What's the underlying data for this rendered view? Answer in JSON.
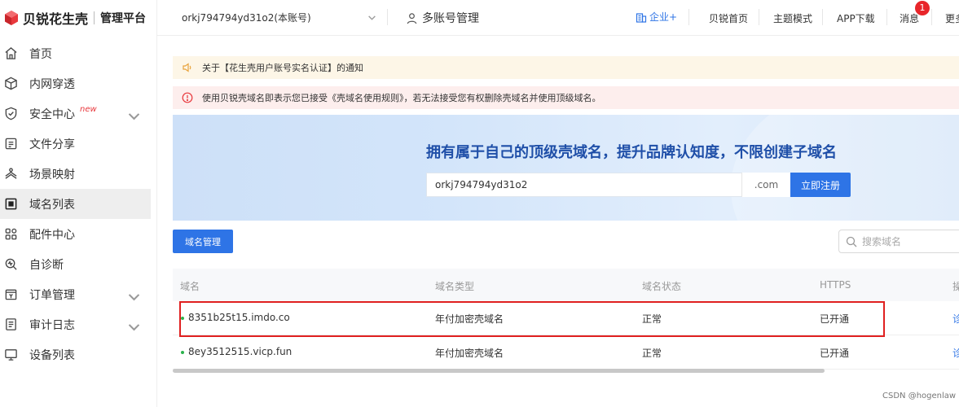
{
  "brand": {
    "name": "贝锐花生壳",
    "subtitle": "管理平台"
  },
  "sidebar": {
    "items": [
      {
        "label": "首页",
        "icon": "home-icon"
      },
      {
        "label": "内网穿透",
        "icon": "cube-icon"
      },
      {
        "label": "安全中心",
        "icon": "shield-icon",
        "badge": "new",
        "expandable": true
      },
      {
        "label": "文件分享",
        "icon": "file-share-icon"
      },
      {
        "label": "场景映射",
        "icon": "scene-icon"
      },
      {
        "label": "域名列表",
        "icon": "domain-list-icon",
        "active": true
      },
      {
        "label": "配件中心",
        "icon": "grid-icon"
      },
      {
        "label": "自诊断",
        "icon": "diagnose-icon"
      },
      {
        "label": "订单管理",
        "icon": "order-icon",
        "expandable": true
      },
      {
        "label": "审计日志",
        "icon": "audit-icon",
        "expandable": true
      },
      {
        "label": "设备列表",
        "icon": "monitor-icon"
      }
    ]
  },
  "topbar": {
    "account": "orkj794794yd31o2(本账号)",
    "multi_account": "多账号管理",
    "enterprise": "企业+",
    "links": [
      "贝锐首页",
      "主题模式",
      "APP下载",
      "消息",
      "更多"
    ],
    "message_count": "1"
  },
  "notices": [
    "关于【花生壳用户账号实名认证】的通知",
    "使用贝锐壳域名即表示您已接受《壳域名使用规则》，若无法接受您有权删除壳域名并使用顶级域名。"
  ],
  "banner": {
    "title": "拥有属于自己的顶级壳域名，提升品牌认知度，不限创建子域名",
    "input_value": "orkj794794yd31o2",
    "suffix": ".com",
    "button": "立即注册"
  },
  "toolbar": {
    "manage_button": "域名管理",
    "search_placeholder": "搜索域名"
  },
  "table": {
    "headers": [
      "域名",
      "域名类型",
      "域名状态",
      "HTTPS",
      "操"
    ],
    "rows": [
      {
        "domain": "8351b25t15.imdo.co",
        "type": "年付加密壳域名",
        "status": "正常",
        "https": "已开通",
        "op": "诊"
      },
      {
        "domain": "8ey3512515.vicp.fun",
        "type": "年付加密壳域名",
        "status": "正常",
        "https": "已开通",
        "op": "诊"
      }
    ]
  },
  "watermark": "CSDN @hogenlaw",
  "colors": {
    "accent": "#2e74e6",
    "brand": "#e8383d",
    "success": "#2bb24c",
    "highlight": "#e02020"
  }
}
